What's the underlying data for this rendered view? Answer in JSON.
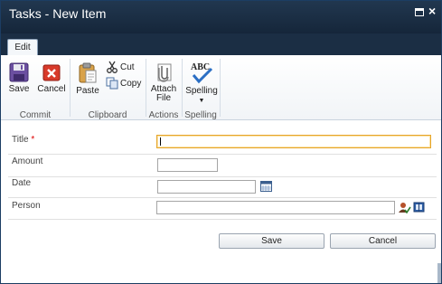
{
  "window": {
    "title": "Tasks - New Item"
  },
  "tabs": [
    {
      "label": "Edit"
    }
  ],
  "ribbon": {
    "commit": {
      "group_label": "Commit",
      "save_label": "Save",
      "cancel_label": "Cancel"
    },
    "clipboard": {
      "group_label": "Clipboard",
      "paste_label": "Paste",
      "cut_label": "Cut",
      "copy_label": "Copy"
    },
    "actions": {
      "group_label": "Actions",
      "attach_line1": "Attach",
      "attach_line2": "File"
    },
    "spelling": {
      "group_label": "Spelling",
      "spelling_label": "Spelling",
      "abc_text": "ABC"
    }
  },
  "form": {
    "title_label": "Title",
    "title_required": "*",
    "title_value": "",
    "amount_label": "Amount",
    "amount_value": "",
    "date_label": "Date",
    "date_value": "",
    "person_label": "Person",
    "person_value": ""
  },
  "buttons": {
    "save_label": "Save",
    "cancel_label": "Cancel"
  },
  "colors": {
    "titlebar": "#1b2e44",
    "focus_border": "#e6a52a",
    "required": "#dd0000"
  }
}
